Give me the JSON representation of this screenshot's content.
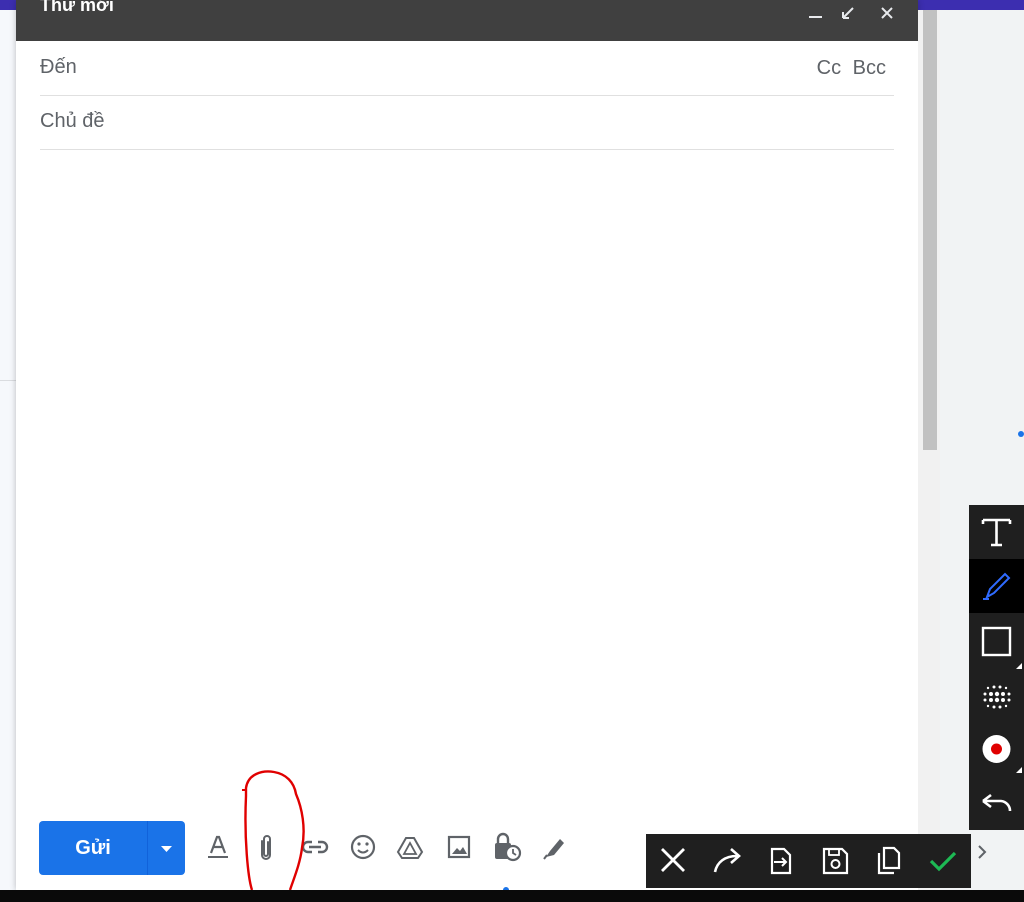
{
  "compose": {
    "title": "Thư mới",
    "to_label": "Đến",
    "cc_label": "Cc",
    "bcc_label": "Bcc",
    "subject_label": "Chủ đề",
    "send_label": "Gửi"
  },
  "colors": {
    "send_blue": "#1a73e8",
    "header_bg": "#404040",
    "annotation_red": "#e00000",
    "pen_blue": "#2f6bff",
    "confirm_green": "#1db954"
  },
  "format_toolbar": {
    "icons": [
      "text-format-icon",
      "attach-icon",
      "link-icon",
      "emoji-icon",
      "drive-icon",
      "image-icon",
      "confidential-icon",
      "signature-icon"
    ]
  },
  "annotation_tools": {
    "side": [
      "text-tool-icon",
      "pen-tool-icon",
      "rectangle-tool-icon",
      "blur-tool-icon",
      "record-tool-icon",
      "undo-icon"
    ],
    "bottom": [
      "cancel-icon",
      "share-icon",
      "export-icon",
      "save-icon",
      "copy-icon",
      "confirm-icon"
    ]
  }
}
